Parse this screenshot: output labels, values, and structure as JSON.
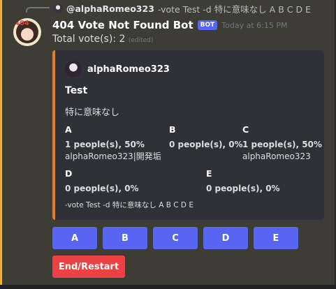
{
  "reply": {
    "username": "@alphaRomeo323",
    "text": "-vote Test -d 特に意味なし A B C D E"
  },
  "message": {
    "bot_name": "404 Vote Not Found Bot",
    "bot_tag": "BOT",
    "timestamp": "Today at 6:15 PM",
    "content": "Total vote(s): 2",
    "edited": "(edited)"
  },
  "embed": {
    "author": "alphaRomeo323",
    "title": "Test",
    "description": "特に意味なし",
    "fields": [
      {
        "name": "A",
        "count": "1 people(s), 50%",
        "voters": "alphaRomeo323|開発垢"
      },
      {
        "name": "B",
        "count": "0 people(s), 0%",
        "voters": ""
      },
      {
        "name": "C",
        "count": "1 people(s), 50%",
        "voters": "alphaRomeo323"
      },
      {
        "name": "D",
        "count": "0 people(s), 0%",
        "voters": ""
      },
      {
        "name": "E",
        "count": "0 people(s), 0%",
        "voters": ""
      }
    ],
    "footer": "-vote Test -d 特に意味なし A B C D E",
    "accent_color": "#e67e22"
  },
  "buttons": {
    "options": [
      "A",
      "B",
      "C",
      "D",
      "E"
    ],
    "end_restart": "End/Restart"
  },
  "colors": {
    "primary_button": "#5865f2",
    "danger_button": "#ed4245",
    "bot_tag": "#5865f2"
  }
}
